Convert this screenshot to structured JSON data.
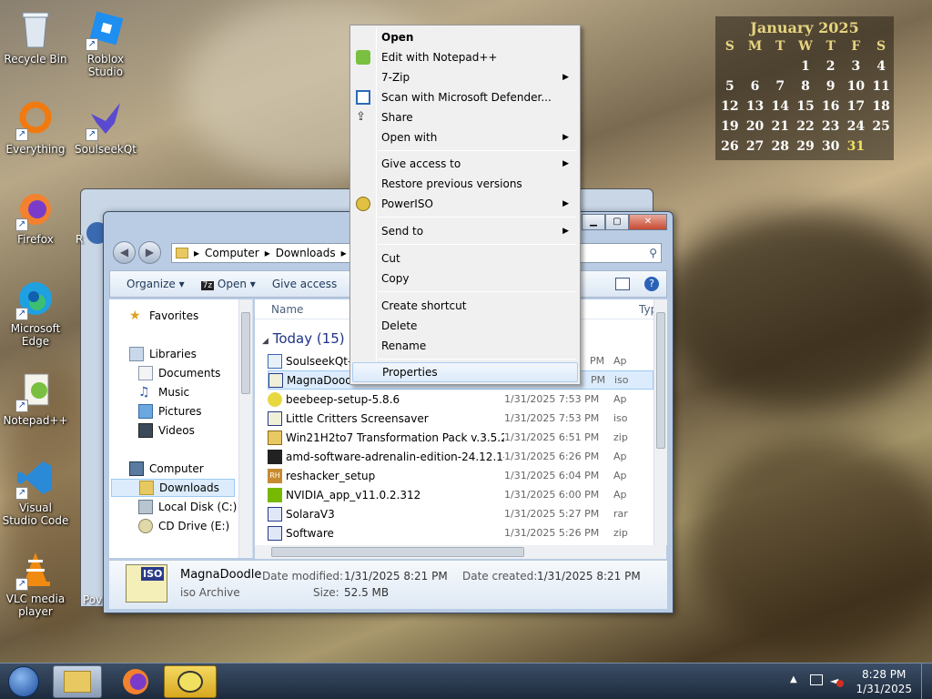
{
  "desktop": {
    "icons": [
      {
        "label": "Recycle Bin"
      },
      {
        "label": "Roblox Studio"
      },
      {
        "label": "Everything"
      },
      {
        "label": "SoulseekQt"
      },
      {
        "label": "Firefox"
      },
      {
        "label": "Microsoft Edge"
      },
      {
        "label": "Notepad++"
      },
      {
        "label": "Visual Studio Code"
      },
      {
        "label": "VLC media player"
      }
    ],
    "partial_labels": [
      "R",
      "Pov"
    ]
  },
  "calendar": {
    "title": "January 2025",
    "weekdays": [
      "S",
      "M",
      "T",
      "W",
      "T",
      "F",
      "S"
    ],
    "weeks": [
      [
        "",
        "",
        "",
        "1",
        "2",
        "3",
        "4"
      ],
      [
        "5",
        "6",
        "7",
        "8",
        "9",
        "10",
        "11"
      ],
      [
        "12",
        "13",
        "14",
        "15",
        "16",
        "17",
        "18"
      ],
      [
        "19",
        "20",
        "21",
        "22",
        "23",
        "24",
        "25"
      ],
      [
        "26",
        "27",
        "28",
        "29",
        "30",
        "31",
        ""
      ]
    ],
    "today": "31"
  },
  "explorer": {
    "address": {
      "crumbs": [
        "Computer",
        "Downloads"
      ]
    },
    "toolbar": {
      "organize": "Organize",
      "open": "Open",
      "give_access": "Give access"
    },
    "nav": {
      "favorites": "Favorites",
      "libraries": "Libraries",
      "documents": "Documents",
      "music": "Music",
      "pictures": "Pictures",
      "videos": "Videos",
      "computer": "Computer",
      "downloads": "Downloads",
      "local_disk": "Local Disk (C:)",
      "cd_drive": "CD Drive (E:)"
    },
    "columns": {
      "name": "Name",
      "type": "Typ"
    },
    "group": "Today (15)",
    "files": [
      {
        "name": "SoulseekQt-",
        "date": "",
        "time_suffix": "PM",
        "type": "Ap"
      },
      {
        "name": "MagnaDood",
        "date": "",
        "time_suffix": "PM",
        "type": "iso",
        "selected": true
      },
      {
        "name": "beebeep-setup-5.8.6",
        "date": "1/31/2025 7:53 PM",
        "type": "Ap"
      },
      {
        "name": "Little Critters Screensaver",
        "date": "1/31/2025 7:53 PM",
        "type": "iso"
      },
      {
        "name": "Win21H2to7 Transformation Pack v.3.5.2",
        "date": "1/31/2025 6:51 PM",
        "type": "zip"
      },
      {
        "name": "amd-software-adrenalin-edition-24.12.1-...",
        "date": "1/31/2025 6:26 PM",
        "type": "Ap"
      },
      {
        "name": "reshacker_setup",
        "date": "1/31/2025 6:04 PM",
        "type": "Ap"
      },
      {
        "name": "NVIDIA_app_v11.0.2.312",
        "date": "1/31/2025 6:00 PM",
        "type": "Ap"
      },
      {
        "name": "SolaraV3",
        "date": "1/31/2025 5:27 PM",
        "type": "rar"
      },
      {
        "name": "Software",
        "date": "1/31/2025 5:26 PM",
        "type": "zip"
      }
    ],
    "details": {
      "name": "MagnaDoodle",
      "kind": "iso Archive",
      "icon_text": "ISO",
      "date_modified_label": "Date modified:",
      "date_modified": "1/31/2025 8:21 PM",
      "date_created_label": "Date created:",
      "date_created": "1/31/2025 8:21 PM",
      "size_label": "Size:",
      "size": "52.5 MB"
    }
  },
  "context_menu": {
    "items": [
      {
        "label": "Open"
      },
      {
        "label": "Edit with Notepad++"
      },
      {
        "label": "7-Zip"
      },
      {
        "label": "Scan with Microsoft Defender..."
      },
      {
        "label": "Share"
      },
      {
        "label": "Open with"
      },
      {
        "label": "Give access to"
      },
      {
        "label": "Restore previous versions"
      },
      {
        "label": "PowerISO"
      },
      {
        "label": "Send to"
      },
      {
        "label": "Cut"
      },
      {
        "label": "Copy"
      },
      {
        "label": "Create shortcut"
      },
      {
        "label": "Delete"
      },
      {
        "label": "Rename"
      },
      {
        "label": "Properties"
      }
    ]
  },
  "taskbar": {
    "clock_time": "8:28 PM",
    "clock_date": "1/31/2025"
  }
}
